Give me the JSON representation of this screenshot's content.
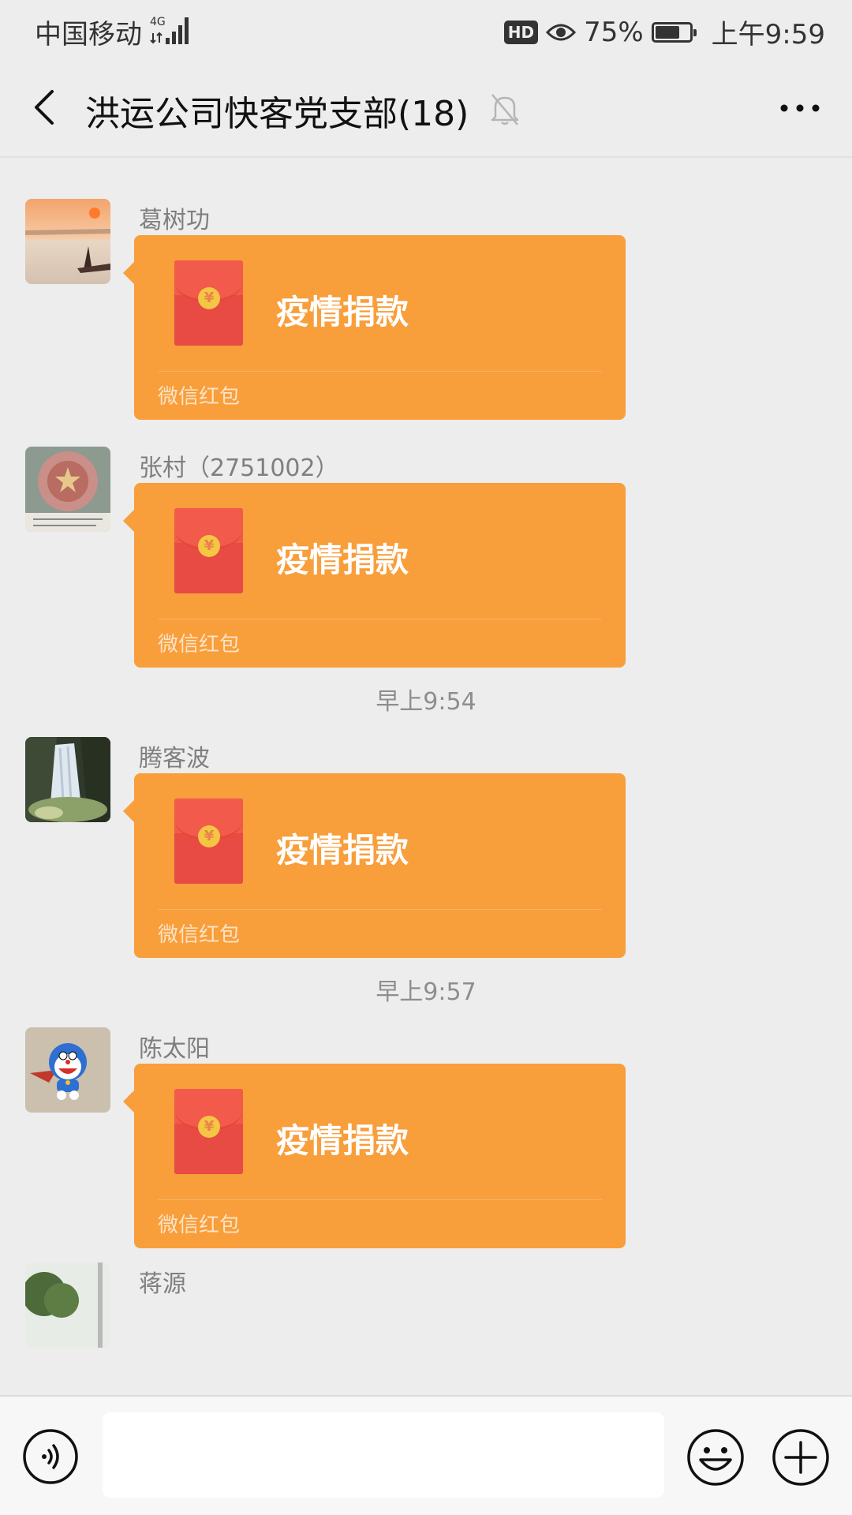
{
  "status_bar": {
    "carrier": "中国移动",
    "network": "4G",
    "hd": "HD",
    "battery_percent": "75%",
    "battery_level": 0.75,
    "time": "上午9:59"
  },
  "header": {
    "title": "洪运公司快客党支部(18)"
  },
  "messages": [
    {
      "sender": "葛树功",
      "title": "疫情捐款",
      "label": "微信红包"
    },
    {
      "sender": "张村（2751002）",
      "title": "疫情捐款",
      "label": "微信红包"
    },
    {
      "time": "早上9:54"
    },
    {
      "sender": "腾客波",
      "title": "疫情捐款",
      "label": "微信红包"
    },
    {
      "time": "早上9:57"
    },
    {
      "sender": "陈太阳",
      "title": "疫情捐款",
      "label": "微信红包"
    },
    {
      "sender": "蒋源"
    }
  ],
  "icons": {
    "back": "back-icon",
    "mute": "bell-off-icon",
    "more": "more-icon",
    "voice": "voice-icon",
    "emoji": "emoji-icon",
    "plus": "plus-icon",
    "red_packet": "red-packet-icon",
    "yen": "¥"
  },
  "colors": {
    "envelope": "#f89e3b",
    "packet": "#f25a4b",
    "background": "#ededed"
  }
}
